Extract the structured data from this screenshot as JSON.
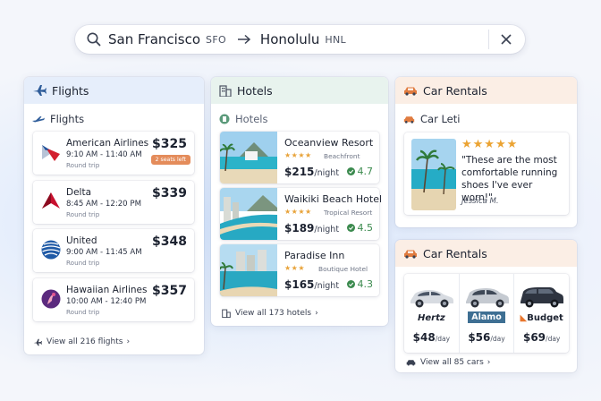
{
  "search": {
    "from_city": "San Francisco",
    "from_code": "SFO",
    "to_city": "Honolulu",
    "to_code": "HNL"
  },
  "flights": {
    "header": "Flights",
    "subheader": "Flights",
    "rows": [
      {
        "airline": "American Airlines",
        "time": "9:10 AM - 11:40 AM",
        "trip": "Round trip",
        "price": "$325",
        "badge": "2 seats left"
      },
      {
        "airline": "Delta",
        "time": "8:45 AM - 12:20 PM",
        "trip": "Round trip",
        "price": "$339"
      },
      {
        "airline": "United",
        "time": "9:00 AM - 11:45 AM",
        "trip": "Round trip",
        "price": "$348"
      },
      {
        "airline": "Hawaiian Airlines",
        "time": "10:00 AM - 12:40 PM",
        "trip": "Round trip",
        "price": "$357"
      }
    ],
    "view_all": "View all 216 flights"
  },
  "hotels": {
    "header": "Hotels",
    "subheader": "Hotels",
    "rows": [
      {
        "name": "Oceanview  Resort",
        "stars": "★★★★",
        "area": "Beachfront",
        "price": "$215",
        "per": "/night",
        "rating": "4.7"
      },
      {
        "name": "Waikiki Beach Hotel",
        "stars": "★★★★",
        "area": "Tropical Resort",
        "price": "$189",
        "per": "/night",
        "rating": "4.5"
      },
      {
        "name": "Paradise Inn",
        "stars": "★★★",
        "area": "Boutique Hotel",
        "price": "$165",
        "per": "/night",
        "rating": "4.3"
      }
    ],
    "view_all": "View all 173 hotels"
  },
  "car_review": {
    "header": "Car Rentals",
    "subheader": "Car Leti",
    "stars": "★★★★★",
    "quote": "\"These are the most comfortable running shoes I've ever worn!\"",
    "author": "Jessica M."
  },
  "cars": {
    "header": "Car Rentals",
    "items": [
      {
        "brand": "Hertz",
        "price": "$48",
        "unit": "/day"
      },
      {
        "brand": "Alamo",
        "price": "$56",
        "unit": "/day"
      },
      {
        "brand": "Budget",
        "price": "$69",
        "unit": "/day"
      }
    ],
    "view_all": "View all 85 cars"
  },
  "colors": {
    "flights_head": "#e6eefb",
    "hotels_head": "#e8f3ee",
    "cars_head": "#fbeee5",
    "accent_orange": "#e48c5b",
    "rating_green": "#3b8a4e",
    "star_gold": "#eba332"
  }
}
